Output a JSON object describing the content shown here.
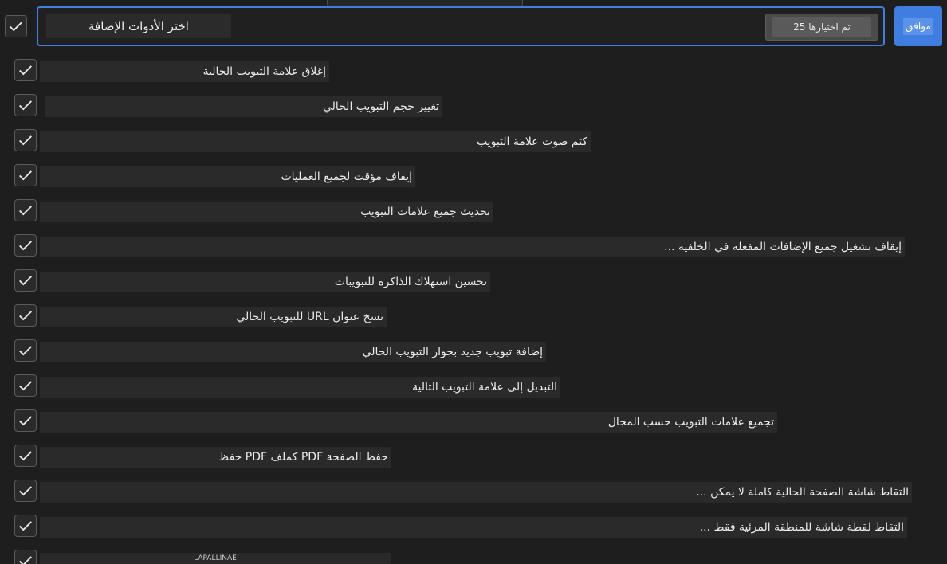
{
  "header": {
    "search_value": "اختر الأدوات الإضافة",
    "select_all_label": "تم اختيارها 25",
    "ok_label": "موافق"
  },
  "items": [
    {
      "label": "إغلاق علامة التبويب الحالية"
    },
    {
      "label": "تغيير حجم التبويب الحالي"
    },
    {
      "label": "كتم صوت علامة التبويب"
    },
    {
      "label": "إيقاف مؤقت لجميع العمليات"
    },
    {
      "label": "تحديث جميع علامات التبويب"
    },
    {
      "label": "إيقاف تشغيل جميع الإضافات المفعلة في الخلفية ... "
    },
    {
      "label": "تحسين استهلاك الذاكرة للتبويبات"
    },
    {
      "label": "نسخ عنوان URL للتبويب الحالي"
    },
    {
      "label": "إضافة تبويب جديد بجوار التبويب الحالي"
    },
    {
      "label": "التبديل إلى علامة التبويب التالية"
    },
    {
      "label": "تجميع علامات التبويب حسب المجال"
    },
    {
      "label": "حفظ الصفحة PDF كملف PDF حفظ"
    },
    {
      "label": "التقاط شاشة الصفحة الحالية كاملة لا يمكن ... "
    },
    {
      "label": "التقاط لقطة شاشة للمنطقة المرئية فقط ... "
    }
  ],
  "partial_item": {
    "label": "LAPALLINAE"
  }
}
